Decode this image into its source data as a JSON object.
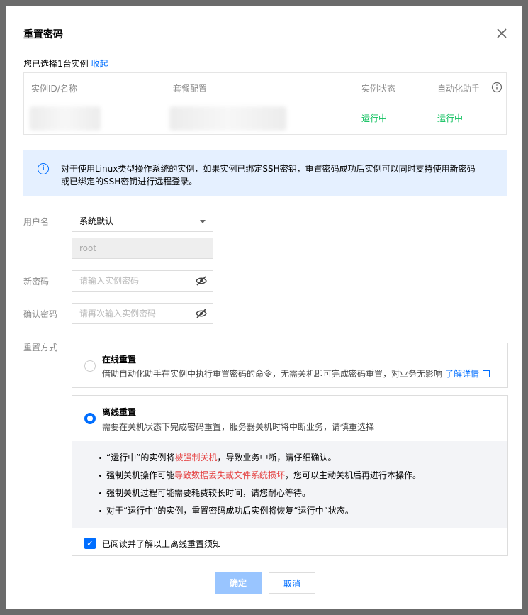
{
  "dialog": {
    "title": "重置密码",
    "selected_text": "您已选择1台实例",
    "collapse_link": "收起"
  },
  "table": {
    "headers": [
      "实例ID/名称",
      "套餐配置",
      "实例状态",
      "自动化助手"
    ],
    "rows": [
      {
        "status": "运行中",
        "assistant": "运行中"
      }
    ]
  },
  "notice": {
    "line1": "对于使用Linux类型操作系统的实例，如果实例已绑定SSH密钥，重置密码成功后实例可以同时支持使用新密码",
    "line2": "或已绑定的SSH密钥进行远程登录。"
  },
  "form": {
    "username_label": "用户名",
    "username_select": "系统默认",
    "username_value": "root",
    "new_password_label": "新密码",
    "new_password_placeholder": "请输入实例密码",
    "confirm_password_label": "确认密码",
    "confirm_password_placeholder": "请再次输入实例密码",
    "reset_mode_label": "重置方式"
  },
  "online_option": {
    "title": "在线重置",
    "desc": "借助自动化助手在实例中执行重置密码的命令，无需关机即可完成密码重置，对业务无影响",
    "link": "了解详情"
  },
  "offline_option": {
    "title": "离线重置",
    "desc": "需要在关机状态下完成密码重置，服务器关机时将中断业务，请慎重选择",
    "bullets": [
      {
        "pre": "“运行中”的实例将",
        "red": "被强制关机",
        "post": "，导致业务中断，请仔细确认。"
      },
      {
        "pre": "强制关机操作可能",
        "red": "导致数据丢失或文件系统损坏",
        "post": "，您可以主动关机后再进行本操作。"
      },
      {
        "pre": "强制关机过程可能需要耗费较长时间，请您耐心等待。",
        "red": "",
        "post": ""
      },
      {
        "pre": "对于“运行中”的实例，重置密码成功后实例将恢复“运行中”状态。",
        "red": "",
        "post": ""
      }
    ],
    "ack_label": "已阅读并了解以上离线重置须知"
  },
  "buttons": {
    "ok": "确定",
    "cancel": "取消"
  },
  "colors": {
    "accent": "#006eff",
    "success": "#0abf5b",
    "danger": "#e54545",
    "notice_bg": "#e5f0ff"
  },
  "icons": [
    "close-icon",
    "info-circle-icon",
    "caret-down-icon",
    "eye-off-icon",
    "external-link-icon",
    "checkbox-checked-icon"
  ]
}
